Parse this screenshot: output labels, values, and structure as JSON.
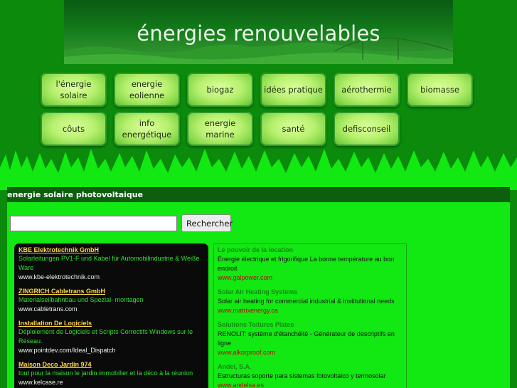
{
  "banner": {
    "title": "énergies renouvelables"
  },
  "nav": {
    "row1": [
      {
        "label": "l'énergie\nsolaire"
      },
      {
        "label": "energie\neolienne"
      },
      {
        "label": "biogaz"
      },
      {
        "label": "idées pratique"
      },
      {
        "label": "aérothermie"
      },
      {
        "label": "biomasse"
      }
    ],
    "row2": [
      {
        "label": "côuts"
      },
      {
        "label": "info\nenergétique"
      },
      {
        "label": "energie\nmarine"
      },
      {
        "label": "santé"
      },
      {
        "label": "defisconseil"
      }
    ]
  },
  "section": {
    "title": "energie solaire photovoltaique"
  },
  "search": {
    "value": "",
    "button_label": "Rechercher"
  },
  "ads_left": [
    {
      "title": "KBE Elektrotechnik GmbH",
      "text": "Solarleitungen PV1-F und Kabel für Automobilindustrie & Weiße Ware",
      "url": "www.kbe-elektrotechnik.com"
    },
    {
      "title": "ZINGRICH Cabletrans GmbH",
      "text": "Materialseilbahnbau und Spezial- montagen",
      "url": "www.cabletrans.com"
    },
    {
      "title": "Installation De Logiciels",
      "text": "Déploiement de Logiciels et Scripts Correctifs Windows sur le Réseau.",
      "url": "www.pointdev.com/Ideal_Dispatch"
    },
    {
      "title": "Maison Deco Jardin 974",
      "text": "tout pour la maison le jardin immobilier et la déco à la réunion",
      "url": "www.kelcase.re"
    }
  ],
  "ads_right": [
    {
      "title": "Le pouvoir de la location",
      "text": "Énergie électrique et frigorifique La bonne température au bon endroit",
      "url": "www.galpower.com"
    },
    {
      "title": "Solar Air Heating Systems",
      "text": "Solar air heating for commercial industrial & institutional needs",
      "url": "www.matrixenergy.ca"
    },
    {
      "title": "Solutions Toitures Plates",
      "text": "RENOLIT: système d'étanchéité - Générateur de descriptifs en ligne",
      "url": "www.alkorproof.com"
    },
    {
      "title": "Andel, S.A.",
      "text": "Estructuras soporte para sistemas fotovoltaico y termosolar",
      "url": "www.andelsa.es"
    }
  ]
}
